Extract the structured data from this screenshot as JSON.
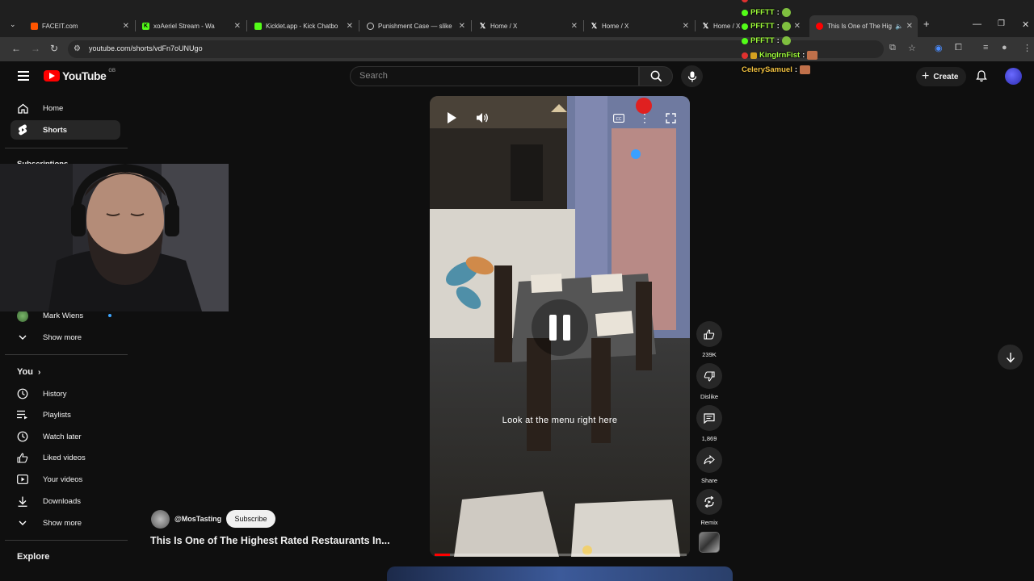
{
  "browser": {
    "tabs": [
      {
        "label": "FACEIT.com",
        "color": "#ff5500"
      },
      {
        "label": "xoAeriel Stream - Wa",
        "color": "#53fc18"
      },
      {
        "label": "Kicklet.app - Kick Chatbo",
        "color": "#53fc18"
      },
      {
        "label": "Punishment Case — slike",
        "color": "#cccccc"
      },
      {
        "label": "Home / X",
        "color": "#ffffff"
      },
      {
        "label": "Home / X",
        "color": "#ffffff"
      },
      {
        "label": "Home / X",
        "color": "#ffffff"
      },
      {
        "label": "This Is One of The Hig",
        "color": "#ff0000"
      }
    ],
    "url": "youtube.com/shorts/vdFn7oUNUgo"
  },
  "header": {
    "logo_text": "YouTube",
    "region": "GB",
    "search_placeholder": "Search",
    "create_label": "Create"
  },
  "sidebar": {
    "home": "Home",
    "shorts": "Shorts",
    "subscriptions": "Subscriptions",
    "sub_channel": "Mark Wiens",
    "show_more_1": "Show more",
    "you": "You",
    "history": "History",
    "playlists": "Playlists",
    "watch_later": "Watch later",
    "liked": "Liked videos",
    "your_videos": "Your videos",
    "downloads": "Downloads",
    "show_more_2": "Show more",
    "explore": "Explore"
  },
  "video": {
    "caption": "Look at the menu right here",
    "progress": 0.06,
    "channel": "@MosTasting",
    "subscribe_label": "Subscribe",
    "title": "This Is One of The Highest Rated Restaurants In..."
  },
  "actions": {
    "likes": "239K",
    "dislike_label": "Dislike",
    "comments": "1,869",
    "share_label": "Share",
    "remix_label": "Remix"
  },
  "chat": [
    {
      "user": "PFFTT",
      "badge": "#53fc18",
      "emote": "#7fbf3f"
    },
    {
      "user": "PFFTT",
      "badge": "#53fc18",
      "emote": "#7fbf3f"
    },
    {
      "user": "PFFTT",
      "badge": "#53fc18",
      "emote": "#7fbf3f"
    },
    {
      "user": "KingIrnFist",
      "badge": "#e0312f",
      "emote": "#c0704a",
      "color": "#9efc3a"
    },
    {
      "user": "CelerySamuel",
      "badge": "",
      "emote": "#c0704a",
      "color": "#f0c040"
    }
  ]
}
